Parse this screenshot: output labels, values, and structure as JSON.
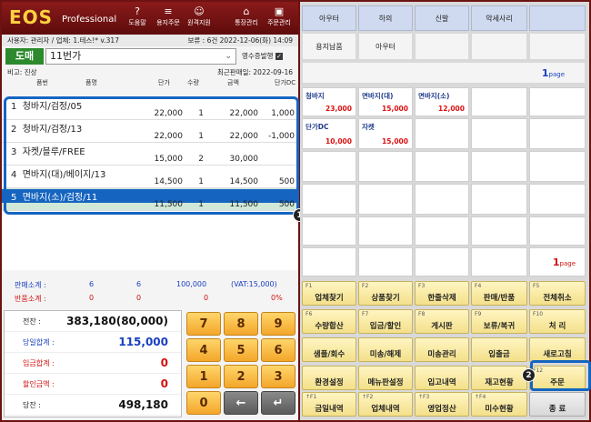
{
  "app": {
    "logo": "EOS",
    "logo_sub": "Professional",
    "toolbar": [
      {
        "icon": "help-icon",
        "glyph": "?",
        "label": "도움말"
      },
      {
        "icon": "box-icon",
        "glyph": "≡",
        "label": "용지주문"
      },
      {
        "icon": "headset-icon",
        "glyph": "☺",
        "label": "원격지원"
      },
      {
        "icon": "bank-icon",
        "glyph": "⌂",
        "label": "통장관리"
      },
      {
        "icon": "gift-icon",
        "glyph": "▣",
        "label": "주문관리"
      }
    ]
  },
  "userbar": {
    "info": "사용자: 관리자 / 업체: 1.테스!* v.317",
    "date": "보류 :   6건  2022-12-06(화) 14:09"
  },
  "sales": {
    "mode_button": "도매",
    "customer": "11번가",
    "receipt_label": "영수증발행",
    "receipt_check": "✓"
  },
  "notebar": {
    "note": "비고: 진상",
    "last_sale": "최근판매일: 2022-09-16"
  },
  "columns": [
    "품번",
    "품명",
    "단가",
    "수량",
    "금액",
    "단가DC"
  ],
  "items": [
    {
      "no": "1",
      "name": "청바지/검정/05",
      "price": "22,000",
      "qty": "1",
      "amount": "22,000",
      "dc": "1,000"
    },
    {
      "no": "2",
      "name": "청바지/검정/13",
      "price": "22,000",
      "qty": "1",
      "amount": "22,000",
      "dc": "-1,000"
    },
    {
      "no": "3",
      "name": "자켓/블루/FREE",
      "price": "15,000",
      "qty": "2",
      "amount": "30,000",
      "dc": ""
    },
    {
      "no": "4",
      "name": "면바지(대)/베이지/13",
      "price": "14,500",
      "qty": "1",
      "amount": "14,500",
      "dc": "500"
    },
    {
      "no": "5",
      "name": "면바지(소)/검정/11",
      "price": "11,500",
      "qty": "1",
      "amount": "11,500",
      "dc": "500"
    }
  ],
  "badges": {
    "one": "1",
    "two": "2"
  },
  "summary": {
    "sale_label": "판매소계 :",
    "sale_qty1": "6",
    "sale_qty2": "6",
    "sale_amount": "100,000",
    "sale_vat": "(VAT:15,000)",
    "return_label": "반품소계 :",
    "ret_qty1": "0",
    "ret_qty2": "0",
    "ret_amount": "0",
    "ret_pct": "0%"
  },
  "totals": [
    {
      "label": "전잔 :",
      "value": "383,180(80,000)",
      "color": "#111111"
    },
    {
      "label": "당일합계 :",
      "value": "115,000",
      "color": "#1a3fc0"
    },
    {
      "label": "입금합계 :",
      "value": "0",
      "color": "#d11111"
    },
    {
      "label": "할인금액 :",
      "value": "0",
      "color": "#d11111"
    },
    {
      "label": "당잔 :",
      "value": "498,180",
      "color": "#111111"
    }
  ],
  "numpad": [
    "7",
    "8",
    "9",
    "4",
    "5",
    "6",
    "1",
    "2",
    "3",
    "0",
    "←",
    "↵"
  ],
  "categories": [
    "아우터",
    "하의",
    "신발",
    "악세사리",
    "",
    "용지납품",
    "아우터",
    "",
    "",
    ""
  ],
  "page_top": {
    "num": "1",
    "unit": "page"
  },
  "page_bottom": {
    "num": "1",
    "unit": "page"
  },
  "products": [
    {
      "name": "청바지",
      "price": "23,000"
    },
    {
      "name": "면바지(대)",
      "price": "15,000"
    },
    {
      "name": "면바지(소)",
      "price": "12,000"
    },
    {
      "name": "단가DC",
      "price": "10,000"
    },
    {
      "name": "자켓",
      "price": "15,000"
    }
  ],
  "fkeys": [
    {
      "key": "F1",
      "label": "업체찾기"
    },
    {
      "key": "F2",
      "label": "상품찾기"
    },
    {
      "key": "F3",
      "label": "한줄삭제"
    },
    {
      "key": "F4",
      "label": "판매/반품"
    },
    {
      "key": "F5",
      "label": "전체취소"
    },
    {
      "key": "F6",
      "label": "수량합산"
    },
    {
      "key": "F7",
      "label": "입금/할인"
    },
    {
      "key": "F8",
      "label": "게시판"
    },
    {
      "key": "F9",
      "label": "보류/복귀"
    },
    {
      "key": "F10",
      "label": "처   리"
    },
    {
      "key": "",
      "label": "샘플/회수"
    },
    {
      "key": "",
      "label": "미송/해제"
    },
    {
      "key": "",
      "label": "미송관리"
    },
    {
      "key": "",
      "label": "입출금"
    },
    {
      "key": "",
      "label": "새로고침"
    },
    {
      "key": "",
      "label": "환경설정"
    },
    {
      "key": "",
      "label": "메뉴판설정"
    },
    {
      "key": "",
      "label": "입고내역"
    },
    {
      "key": "",
      "label": "재고현황"
    },
    {
      "key": "F12",
      "label": "주문"
    },
    {
      "key": "↑F1",
      "label": "금일내역"
    },
    {
      "key": "↑F2",
      "label": "업체내역"
    },
    {
      "key": "↑F3",
      "label": "영업정산"
    },
    {
      "key": "↑F4",
      "label": "미수현황"
    },
    {
      "key": "",
      "label": "종   료"
    }
  ]
}
